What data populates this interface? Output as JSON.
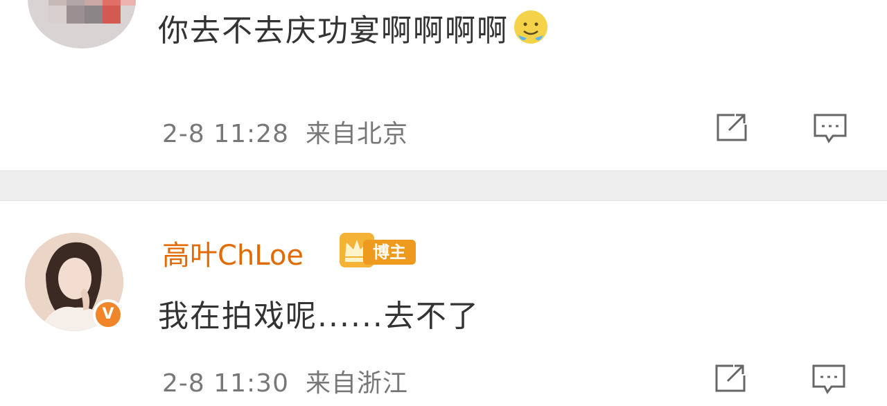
{
  "comments": [
    {
      "text": "你去不去庆功宴啊啊啊啊",
      "emoji": "tear-smile-emoji",
      "time": "2-8 11:28",
      "source": "来自北京",
      "actions": [
        "share-icon",
        "reply-icon"
      ]
    },
    {
      "username": "高叶ChLoe",
      "badge": "博主",
      "text": "我在拍戏呢......去不了",
      "time": "2-8 11:30",
      "source": "来自浙江",
      "verified_badge": "V",
      "actions": [
        "share-icon",
        "reply-icon"
      ]
    }
  ],
  "colors": {
    "username": "#e26a00",
    "text": "#333333",
    "meta": "#777777",
    "divider": "#eeeeee",
    "badge": "#ee9a1e"
  }
}
